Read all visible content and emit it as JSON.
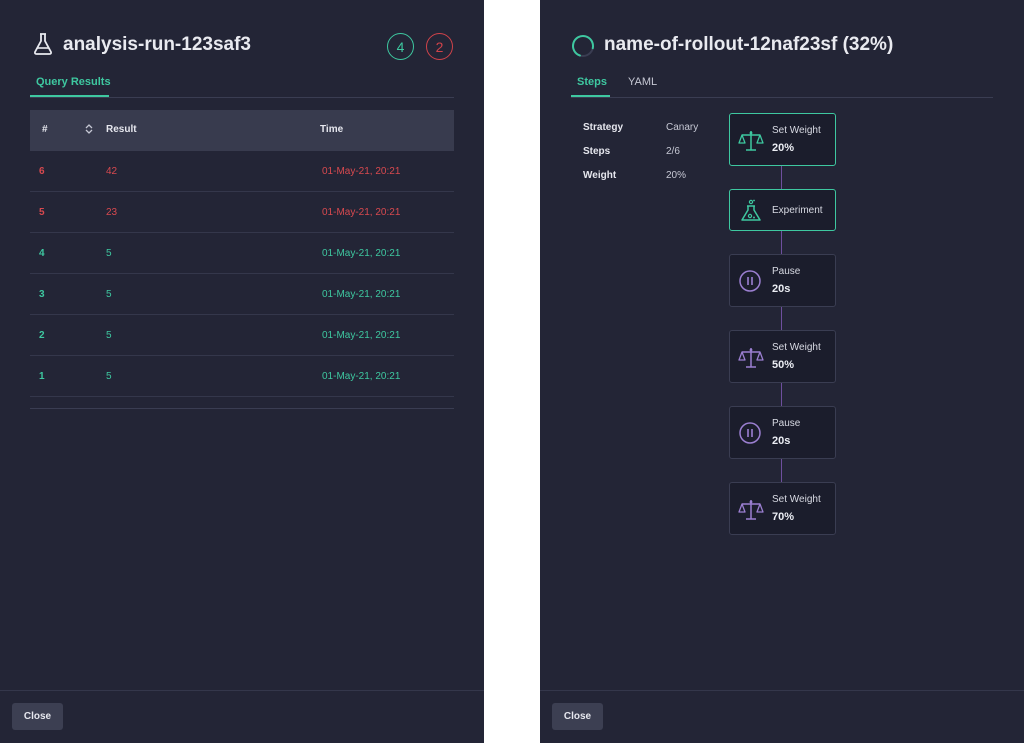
{
  "analysis": {
    "title": "analysis-run-123saf3",
    "success_count": "4",
    "fail_count": "2",
    "tab": "Query Results",
    "table": {
      "headers": {
        "num": "#",
        "result": "Result",
        "time": "Time"
      },
      "rows": [
        {
          "num": "6",
          "result": "42",
          "time": "01-May-21, 20:21",
          "status": "fail"
        },
        {
          "num": "5",
          "result": "23",
          "time": "01-May-21, 20:21",
          "status": "fail"
        },
        {
          "num": "4",
          "result": "5",
          "time": "01-May-21, 20:21",
          "status": "ok"
        },
        {
          "num": "3",
          "result": "5",
          "time": "01-May-21, 20:21",
          "status": "ok"
        },
        {
          "num": "2",
          "result": "5",
          "time": "01-May-21, 20:21",
          "status": "ok"
        },
        {
          "num": "1",
          "result": "5",
          "time": "01-May-21, 20:21",
          "status": "ok"
        }
      ]
    },
    "close_label": "Close"
  },
  "rollout": {
    "title": "name-of-rollout-12naf23sf (32%)",
    "progress": 0.32,
    "tabs": [
      "Steps",
      "YAML"
    ],
    "info": {
      "strategy_label": "Strategy",
      "strategy_value": "Canary",
      "steps_label": "Steps",
      "steps_value": "2/6",
      "weight_label": "Weight",
      "weight_value": "20%"
    },
    "steps": [
      {
        "icon": "scale-icon",
        "label": "Set Weight",
        "value": "20%",
        "state": "done"
      },
      {
        "icon": "flask-icon",
        "label": "Experiment",
        "value": "",
        "state": "done"
      },
      {
        "icon": "pause-icon",
        "label": "Pause",
        "value": "20s",
        "state": "pending"
      },
      {
        "icon": "scale-icon",
        "label": "Set Weight",
        "value": "50%",
        "state": "pending"
      },
      {
        "icon": "pause-icon",
        "label": "Pause",
        "value": "20s",
        "state": "pending"
      },
      {
        "icon": "scale-icon",
        "label": "Set Weight",
        "value": "70%",
        "state": "pending"
      }
    ],
    "close_label": "Close"
  },
  "colors": {
    "panel_bg": "#232536",
    "success": "#3ec8a0",
    "fail": "#d0434a",
    "pending_icon": "#9b7fd1"
  }
}
